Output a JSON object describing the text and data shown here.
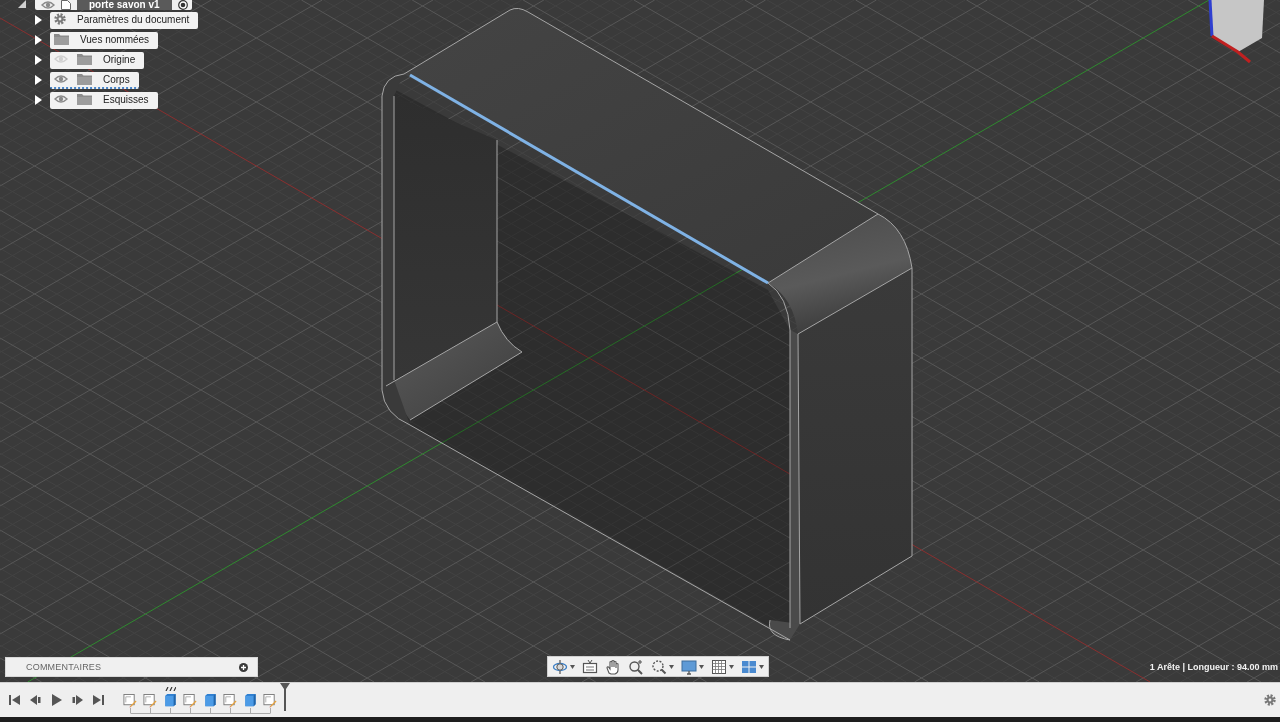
{
  "browser": {
    "root": {
      "label": "porte savon v1",
      "expanded": true,
      "visible": true,
      "active": true
    },
    "items": [
      {
        "kind": "settings",
        "label": "Paramètres du document",
        "expanded": false,
        "selected": false
      },
      {
        "kind": "folder",
        "label": "Vues nommées",
        "expanded": false,
        "selected": false
      },
      {
        "kind": "folder",
        "label": "Origine",
        "expanded": false,
        "visible": false,
        "selected": false
      },
      {
        "kind": "folder",
        "label": "Corps",
        "expanded": false,
        "visible": true,
        "selected": true
      },
      {
        "kind": "folder",
        "label": "Esquisses",
        "expanded": false,
        "visible": true,
        "selected": false
      }
    ]
  },
  "model": {
    "edge_selected": true
  },
  "comments": {
    "title": "COMMENTAIRES"
  },
  "navigation_toolbar": [
    {
      "kind": "orbit",
      "menu": true
    },
    {
      "kind": "look_at",
      "menu": false
    },
    {
      "kind": "pan",
      "menu": false
    },
    {
      "kind": "zoom",
      "menu": false
    },
    {
      "kind": "fit",
      "menu": true
    },
    {
      "kind": "display",
      "menu": true
    },
    {
      "kind": "grid",
      "menu": true
    },
    {
      "kind": "viewports",
      "menu": true
    }
  ],
  "status": "1 Arête | Longueur : 94.00 mm",
  "timeline": {
    "controls": [
      {
        "kind": "first"
      },
      {
        "kind": "previous"
      },
      {
        "kind": "play"
      },
      {
        "kind": "next"
      },
      {
        "kind": "last"
      }
    ],
    "features": [
      {
        "kind": "sketch",
        "marked": false
      },
      {
        "kind": "sketch",
        "marked": false
      },
      {
        "kind": "body",
        "marked": true
      },
      {
        "kind": "sketch",
        "marked": false
      },
      {
        "kind": "body",
        "marked": false
      },
      {
        "kind": "sketch",
        "marked": false
      },
      {
        "kind": "body",
        "marked": false
      },
      {
        "kind": "sketch",
        "marked": false
      }
    ]
  }
}
